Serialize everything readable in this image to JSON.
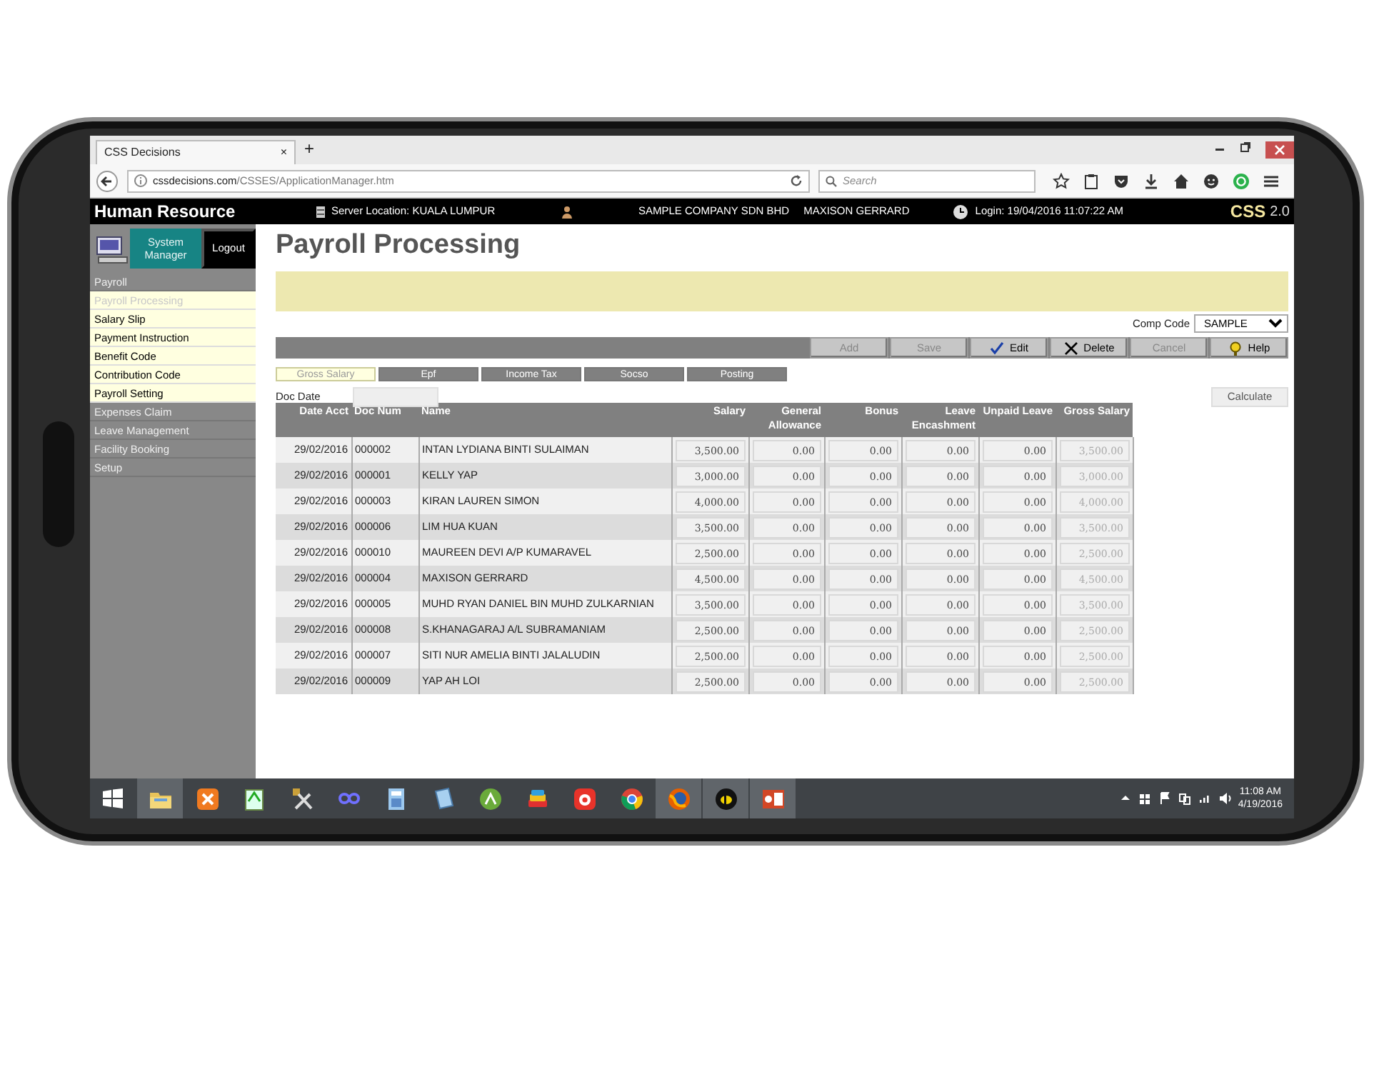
{
  "browser": {
    "tab_title": "CSS Decisions",
    "close_tab": "×",
    "new_tab": "+",
    "url": "**cssdecisions.com**/CSSES/ApplicationManager.htm",
    "search_placeholder": "Search"
  },
  "header": {
    "app_title": "Human Resource",
    "server": "Server Location: KUALA LUMPUR",
    "company": "SAMPLE COMPANY SDN BHD",
    "user": "MAXISON GERRARD",
    "login": "Login: 19/04/2016 11:07:22 AM",
    "brand": "CSS",
    "version": "2.0"
  },
  "sidebar": {
    "user": "System Manager",
    "logout": "Logout",
    "items": [
      {
        "label": "Payroll",
        "kind": "group",
        "selected": false
      },
      {
        "label": "Payroll Processing",
        "kind": "item",
        "selected": true
      },
      {
        "label": "Salary Slip",
        "kind": "item",
        "selected": false
      },
      {
        "label": "Payment Instruction",
        "kind": "item",
        "selected": false
      },
      {
        "label": "Benefit Code",
        "kind": "item",
        "selected": false
      },
      {
        "label": "Contribution Code",
        "kind": "item",
        "selected": false
      },
      {
        "label": "Payroll Setting",
        "kind": "item",
        "selected": false
      },
      {
        "label": "Expenses Claim",
        "kind": "group",
        "selected": false
      },
      {
        "label": "Leave Management",
        "kind": "group",
        "selected": false
      },
      {
        "label": "Facility Booking",
        "kind": "group",
        "selected": false
      },
      {
        "label": "Setup",
        "kind": "group",
        "selected": false
      }
    ]
  },
  "page": {
    "title": "Payroll Processing",
    "comp_code_label": "Comp Code",
    "comp_code": "SAMPLE",
    "toolbar": [
      {
        "label": "Add",
        "kind": "plain",
        "disabled": true
      },
      {
        "label": "Save",
        "kind": "plain",
        "disabled": true
      },
      {
        "label": "Edit",
        "kind": "edit",
        "disabled": false
      },
      {
        "label": "Delete",
        "kind": "delete",
        "disabled": false
      },
      {
        "label": "Cancel",
        "kind": "plain",
        "disabled": true
      },
      {
        "label": "Help",
        "kind": "help",
        "disabled": false
      }
    ],
    "tabs": [
      {
        "label": "Gross Salary",
        "selected": true
      },
      {
        "label": "Epf",
        "selected": false
      },
      {
        "label": "Income Tax",
        "selected": false
      },
      {
        "label": "Socso",
        "selected": false
      },
      {
        "label": "Posting",
        "selected": false
      }
    ],
    "doc_date_label": "Doc Date",
    "calculate": "Calculate"
  },
  "table": {
    "columns": [
      "Date Acct",
      "Doc Num",
      "Name",
      "Salary",
      "General Allowance",
      "Bonus",
      "Leave Encashment",
      "Unpaid Leave",
      "Gross Salary"
    ],
    "rows": [
      {
        "date": "29/02/2016",
        "doc": "000002",
        "name": "INTAN LYDIANA BINTI SULAIMAN",
        "salary": "3,500.00",
        "allowance": "0.00",
        "bonus": "0.00",
        "encashment": "0.00",
        "unpaid": "0.00",
        "gross": "3,500.00"
      },
      {
        "date": "29/02/2016",
        "doc": "000001",
        "name": "KELLY YAP",
        "salary": "3,000.00",
        "allowance": "0.00",
        "bonus": "0.00",
        "encashment": "0.00",
        "unpaid": "0.00",
        "gross": "3,000.00"
      },
      {
        "date": "29/02/2016",
        "doc": "000003",
        "name": "KIRAN LAUREN SIMON",
        "salary": "4,000.00",
        "allowance": "0.00",
        "bonus": "0.00",
        "encashment": "0.00",
        "unpaid": "0.00",
        "gross": "4,000.00"
      },
      {
        "date": "29/02/2016",
        "doc": "000006",
        "name": "LIM HUA KUAN",
        "salary": "3,500.00",
        "allowance": "0.00",
        "bonus": "0.00",
        "encashment": "0.00",
        "unpaid": "0.00",
        "gross": "3,500.00"
      },
      {
        "date": "29/02/2016",
        "doc": "000010",
        "name": "MAUREEN DEVI A/P KUMARAVEL",
        "salary": "2,500.00",
        "allowance": "0.00",
        "bonus": "0.00",
        "encashment": "0.00",
        "unpaid": "0.00",
        "gross": "2,500.00"
      },
      {
        "date": "29/02/2016",
        "doc": "000004",
        "name": "MAXISON GERRARD",
        "salary": "4,500.00",
        "allowance": "0.00",
        "bonus": "0.00",
        "encashment": "0.00",
        "unpaid": "0.00",
        "gross": "4,500.00"
      },
      {
        "date": "29/02/2016",
        "doc": "000005",
        "name": "MUHD RYAN DANIEL BIN MUHD ZULKARNIAN",
        "salary": "3,500.00",
        "allowance": "0.00",
        "bonus": "0.00",
        "encashment": "0.00",
        "unpaid": "0.00",
        "gross": "3,500.00"
      },
      {
        "date": "29/02/2016",
        "doc": "000008",
        "name": "S.KHANAGARAJ A/L SUBRAMANIAM",
        "salary": "2,500.00",
        "allowance": "0.00",
        "bonus": "0.00",
        "encashment": "0.00",
        "unpaid": "0.00",
        "gross": "2,500.00"
      },
      {
        "date": "29/02/2016",
        "doc": "000007",
        "name": "SITI NUR AMELIA BINTI JALALUDIN",
        "salary": "2,500.00",
        "allowance": "0.00",
        "bonus": "0.00",
        "encashment": "0.00",
        "unpaid": "0.00",
        "gross": "2,500.00"
      },
      {
        "date": "29/02/2016",
        "doc": "000009",
        "name": "YAP AH LOI",
        "salary": "2,500.00",
        "allowance": "0.00",
        "bonus": "0.00",
        "encashment": "0.00",
        "unpaid": "0.00",
        "gross": "2,500.00"
      }
    ]
  },
  "taskbar": {
    "apps": [
      {
        "kind": "folder",
        "open": true
      },
      {
        "kind": "xampp",
        "open": false
      },
      {
        "kind": "notepad",
        "open": false
      },
      {
        "kind": "tools",
        "open": false
      },
      {
        "kind": "infinity",
        "open": false
      },
      {
        "kind": "calculator",
        "open": false
      },
      {
        "kind": "notebook",
        "open": false
      },
      {
        "kind": "android",
        "open": false
      },
      {
        "kind": "stack",
        "open": false
      },
      {
        "kind": "player",
        "open": false
      },
      {
        "kind": "chrome",
        "open": false
      },
      {
        "kind": "firefox",
        "open": true
      },
      {
        "kind": "bee",
        "open": true
      },
      {
        "kind": "slides",
        "open": true
      }
    ],
    "time": "11:08 AM",
    "date": "4/19/2016"
  }
}
